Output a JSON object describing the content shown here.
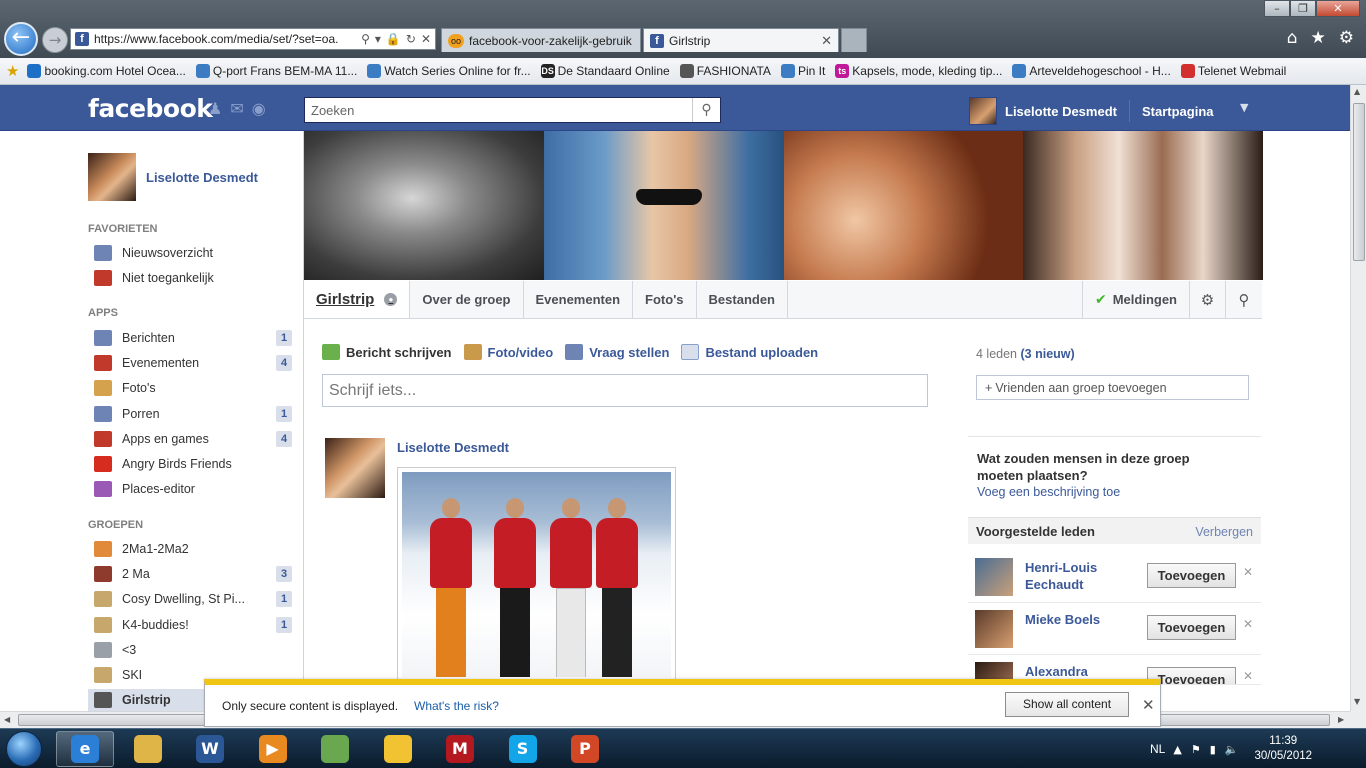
{
  "browser": {
    "url": "https://www.facebook.com/media/set/?set=oa.",
    "tabs": [
      {
        "title": "facebook-voor-zakelijk-gebruik"
      },
      {
        "title": "Girlstrip"
      }
    ],
    "favorites": [
      {
        "label": "booking.com Hotel Ocea...",
        "color": "#1e6fc8"
      },
      {
        "label": "Q-port  Frans BEM-MA 11...",
        "color": "#3b7cc2"
      },
      {
        "label": "Watch Series Online for fr...",
        "color": "#3b7cc2"
      },
      {
        "label": "De Standaard Online",
        "color": "#222222",
        "text": "DS"
      },
      {
        "label": "FASHIONATA",
        "color": "#555555"
      },
      {
        "label": "Pin It",
        "color": "#3b7cc2"
      },
      {
        "label": "Kapsels, mode, kleding tip...",
        "color": "#c1189a",
        "text": "ts"
      },
      {
        "label": "Arteveldehogeschool - H...",
        "color": "#3b7cc2"
      },
      {
        "label": "Telenet Webmail",
        "color": "#d22f2f"
      }
    ]
  },
  "facebook": {
    "logo": "facebook",
    "search_placeholder": "Zoeken",
    "user_name": "Liselotte Desmedt",
    "home_label": "Startpagina"
  },
  "sidebar": {
    "profile_name": "Liselotte Desmedt",
    "favorites_heading": "FAVORIETEN",
    "favorites": [
      {
        "label": "Nieuwsoverzicht",
        "icon": "news-feed-icon",
        "color": "#6d84b4"
      },
      {
        "label": "Niet toegankelijk",
        "icon": "blocked-icon",
        "color": "#c0392b"
      }
    ],
    "apps_heading": "APPS",
    "apps": [
      {
        "label": "Berichten",
        "icon": "messages-icon",
        "count": "1",
        "color": "#6d84b4"
      },
      {
        "label": "Evenementen",
        "icon": "calendar-icon",
        "count": "4",
        "color": "#c0392b"
      },
      {
        "label": "Foto's",
        "icon": "photos-icon",
        "count": "",
        "color": "#d4a24c"
      },
      {
        "label": "Porren",
        "icon": "poke-icon",
        "count": "1",
        "color": "#6d84b4"
      },
      {
        "label": "Apps en games",
        "icon": "games-icon",
        "count": "4",
        "color": "#c0392b"
      },
      {
        "label": "Angry Birds Friends",
        "icon": "angry-birds-icon",
        "count": "",
        "color": "#d62b1f"
      },
      {
        "label": "Places-editor",
        "icon": "places-pin-icon",
        "count": "",
        "color": "#9b59b6"
      }
    ],
    "groups_heading": "GROEPEN",
    "groups": [
      {
        "label": "2Ma1-2Ma2",
        "icon": "group-fish-icon",
        "count": "",
        "color": "#e08a3a"
      },
      {
        "label": "2 Ma",
        "icon": "group-books-icon",
        "count": "3",
        "color": "#8e3b2e"
      },
      {
        "label": "Cosy Dwelling, St Pi...",
        "icon": "group-icon",
        "count": "1",
        "color": "#c7a76b"
      },
      {
        "label": "K4-buddies!",
        "icon": "group-icon",
        "count": "1",
        "color": "#c7a76b"
      },
      {
        "label": "<3",
        "icon": "group-book-icon",
        "count": "",
        "color": "#9aa0a8"
      },
      {
        "label": "SKI",
        "icon": "group-icon",
        "count": "",
        "color": "#c7a76b"
      },
      {
        "label": "Girlstrip",
        "icon": "sunglasses-icon",
        "count": "",
        "color": "#555555"
      }
    ]
  },
  "group": {
    "title": "Girlstrip",
    "nav": [
      "Over de groep",
      "Evenementen",
      "Foto's",
      "Bestanden"
    ],
    "notifications_label": "Meldingen",
    "composer": {
      "actions": [
        "Bericht schrijven",
        "Foto/video",
        "Vraag stellen",
        "Bestand uploaden"
      ],
      "placeholder": "Schrijf iets..."
    },
    "post": {
      "author": "Liselotte Desmedt"
    },
    "members": {
      "count_label": "4 leden",
      "new_label": "(3 nieuw)",
      "add_friends_label": "Vrienden aan groep toevoegen"
    },
    "description_question": "Wat zouden mensen in deze groep moeten plaatsen?",
    "add_description_label": "Voeg een beschrijving toe",
    "suggestions": {
      "title": "Voorgestelde leden",
      "hide_label": "Verbergen",
      "add_label": "Toevoegen",
      "people": [
        {
          "name": "Henri-Louis Eechaudt"
        },
        {
          "name": "Mieke Boels"
        },
        {
          "name": "Alexandra"
        }
      ]
    }
  },
  "infobar": {
    "message": "Only secure content is displayed.",
    "risk_link": "What's the risk?",
    "button": "Show all content"
  },
  "taskbar": {
    "apps": [
      {
        "icon": "internet-explorer-icon",
        "color": "#2b7fd6",
        "glyph": "e",
        "active": true
      },
      {
        "icon": "file-explorer-icon",
        "color": "#e0b548",
        "glyph": "",
        "active": false
      },
      {
        "icon": "word-icon",
        "color": "#2b5797",
        "glyph": "W",
        "active": false
      },
      {
        "icon": "media-player-icon",
        "color": "#e88a1f",
        "glyph": "▶",
        "active": false
      },
      {
        "icon": "picture-viewer-icon",
        "color": "#6aa84f",
        "glyph": "",
        "active": false
      },
      {
        "icon": "norton-icon",
        "color": "#f1c232",
        "glyph": "",
        "active": false
      },
      {
        "icon": "mcafee-icon",
        "color": "#b3191f",
        "glyph": "M",
        "active": false
      },
      {
        "icon": "skype-icon",
        "color": "#12a5e8",
        "glyph": "S",
        "active": false
      },
      {
        "icon": "powerpoint-icon",
        "color": "#d24726",
        "glyph": "P",
        "active": false
      }
    ],
    "language": "NL",
    "time": "11:39",
    "date": "30/05/2012"
  }
}
